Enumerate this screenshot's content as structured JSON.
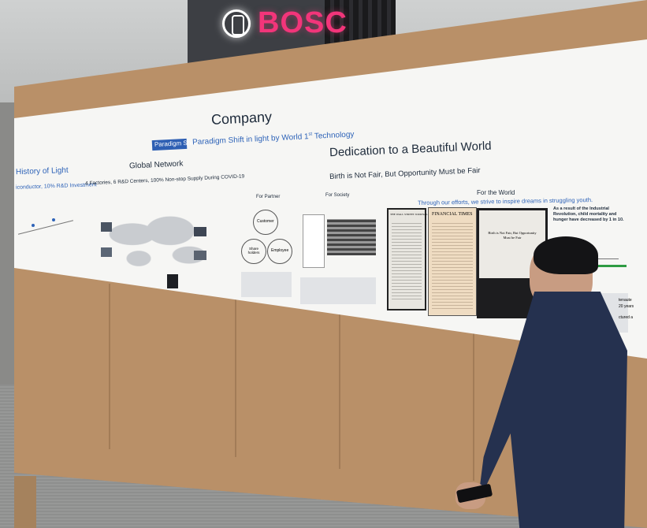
{
  "sign": {
    "brand": "BOSC"
  },
  "banner": {
    "company_title": "Company",
    "paradigm_tag": "Paradigm Shift",
    "paradigm_line_pre": "Paradigm Shift in light by World 1",
    "paradigm_sup": "st",
    "paradigm_line_post": " Technology",
    "history_title": "History of Light",
    "history_sub": "iconductor, 10% R&D Investment",
    "global_title": "Global Network",
    "global_sub": "4 Factories, 6 R&D Centers, 100% Non-stop Supply During COVID-19",
    "dedication_title": "Dedication to a Beautiful World",
    "dedication_sub": "Birth is Not Fair, But Opportunity Must be Fair",
    "for_partner": "For Partner",
    "for_society": "For Society",
    "for_planet": "For the World",
    "planet_sub": "Through our efforts, we strive to inspire dreams in struggling youth.",
    "circle_customer": "Customer",
    "circle_share": "Share holders",
    "circle_employee": "Employee",
    "newspaper_1": "THE WALL STREET JOURNAL",
    "newspaper_2": "FINANCIAL TIMES",
    "newspaper_3_head": "Birth is Not Fair, But Opportunity Must be Fair",
    "industrial_text": "As a result of the Industrial Revolution, child mortality and hunger have decreased by 1 in 10.",
    "side_fragment_1": "tenaute",
    "side_fragment_2": "20 years",
    "side_fragment_3": "ctured a"
  },
  "colors": {
    "tag_blue": "#2e5fb3",
    "sign_pink": "#f2357a",
    "cardboard": "#b99068",
    "banner": "#f6f6f4"
  }
}
